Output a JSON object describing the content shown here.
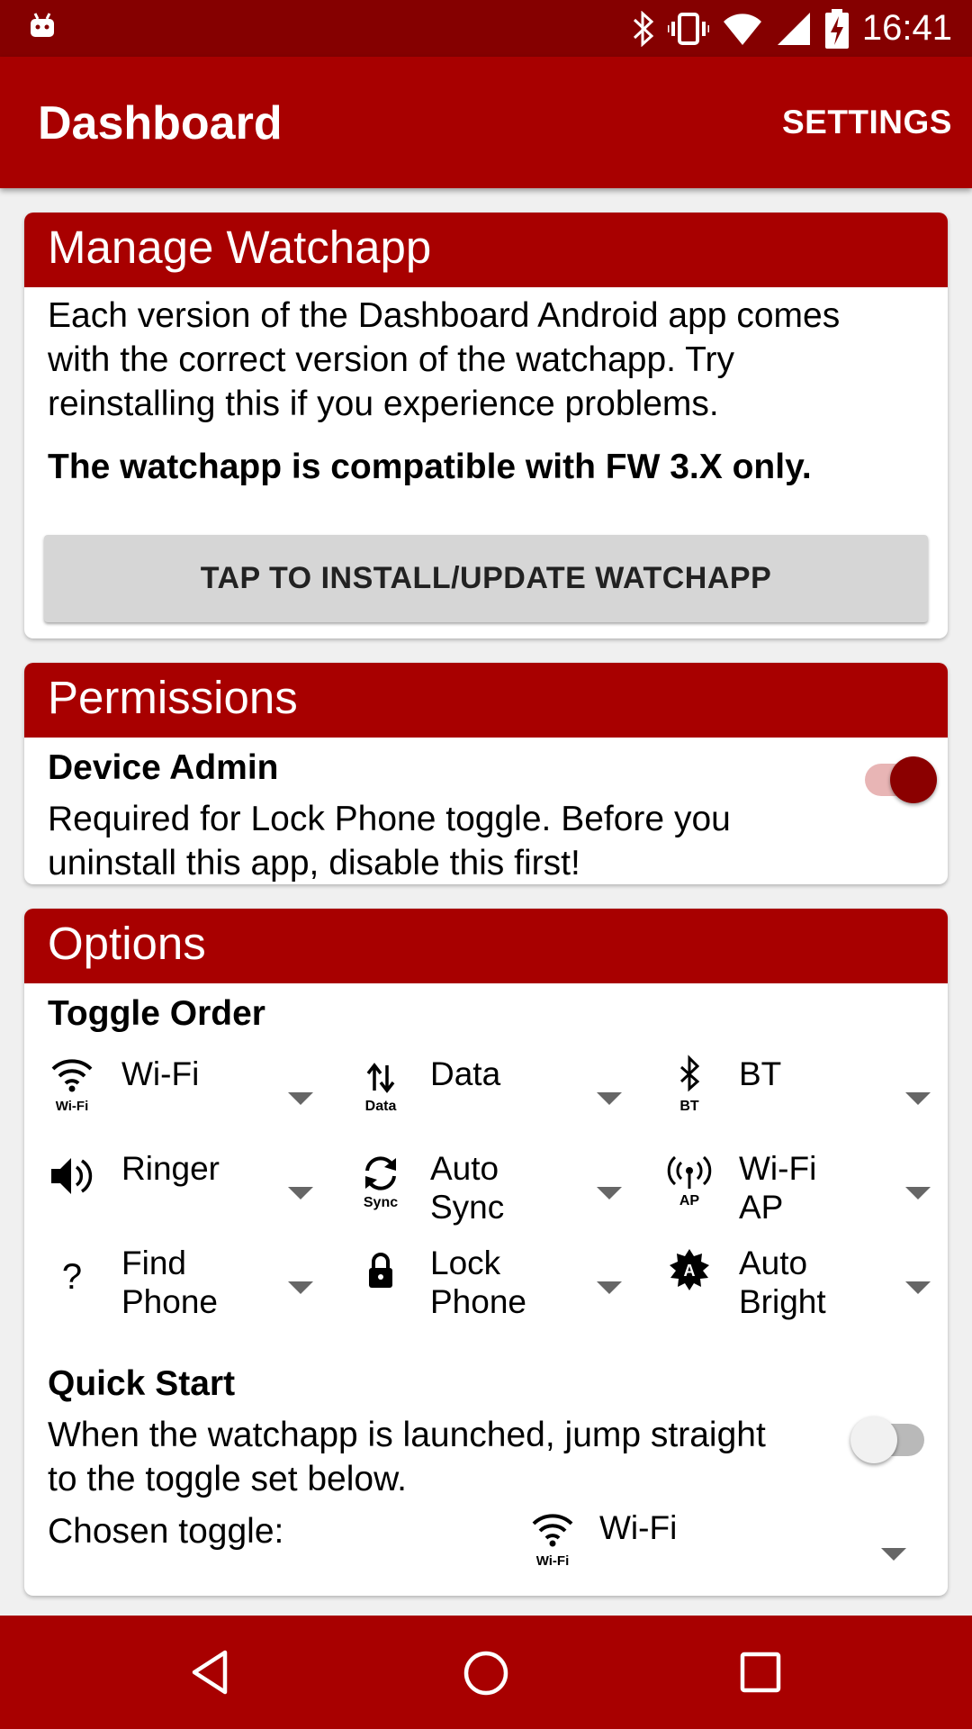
{
  "status_bar": {
    "time": "16:41",
    "icons": [
      "android-icon",
      "bluetooth-icon",
      "vibrate-icon",
      "wifi-icon",
      "signal-icon",
      "battery-charging-icon"
    ]
  },
  "app_bar": {
    "title": "Dashboard",
    "settings_label": "SETTINGS"
  },
  "manage_watchapp": {
    "header": "Manage Watchapp",
    "line1": "Each version of the Dashboard Android app comes",
    "line2": "with the correct version of the watchapp. Try",
    "line3": "reinstalling this if you experience problems.",
    "compat_note": "The watchapp is compatible with FW 3.X only.",
    "install_button": "TAP TO INSTALL/UPDATE WATCHAPP"
  },
  "permissions": {
    "header": "Permissions",
    "device_admin_title": "Device Admin",
    "line1": "Required for Lock Phone toggle. Before you",
    "line2": "uninstall this app, disable this first!",
    "device_admin_enabled": true
  },
  "options": {
    "header": "Options",
    "toggle_order_title": "Toggle Order",
    "toggles": [
      {
        "line1": "Wi-Fi",
        "line2": "",
        "icon": "wifi-icon",
        "icon_caption": "Wi-Fi"
      },
      {
        "line1": "Data",
        "line2": "",
        "icon": "data-icon",
        "icon_caption": "Data"
      },
      {
        "line1": "BT",
        "line2": "",
        "icon": "bluetooth-icon",
        "icon_caption": "BT"
      },
      {
        "line1": "Ringer",
        "line2": "",
        "icon": "speaker-icon",
        "icon_caption": ""
      },
      {
        "line1": "Auto",
        "line2": "Sync",
        "icon": "sync-icon",
        "icon_caption": "Sync"
      },
      {
        "line1": "Wi-Fi",
        "line2": "AP",
        "icon": "hotspot-icon",
        "icon_caption": "AP"
      },
      {
        "line1": "Find",
        "line2": "Phone",
        "icon": "question-icon",
        "icon_caption": ""
      },
      {
        "line1": "Lock",
        "line2": "Phone",
        "icon": "lock-icon",
        "icon_caption": ""
      },
      {
        "line1": "Auto",
        "line2": "Bright",
        "icon": "auto-brightness-icon",
        "icon_caption": ""
      }
    ],
    "quick_start_title": "Quick Start",
    "quick_start_line1": "When the watchapp is launched, jump straight",
    "quick_start_line2": "to the toggle set below.",
    "quick_start_enabled": false,
    "chosen_toggle_label": "Chosen toggle:",
    "chosen_toggle_value": "Wi-Fi",
    "chosen_toggle_icon_caption": "Wi-Fi"
  },
  "colors": {
    "status_bar": "#850000",
    "primary": "#a80000",
    "switch_on_thumb": "#8b0000",
    "switch_on_track": "#e8b5b5"
  },
  "nav_bar": {
    "icons": [
      "back-icon",
      "home-icon",
      "recents-icon"
    ]
  }
}
